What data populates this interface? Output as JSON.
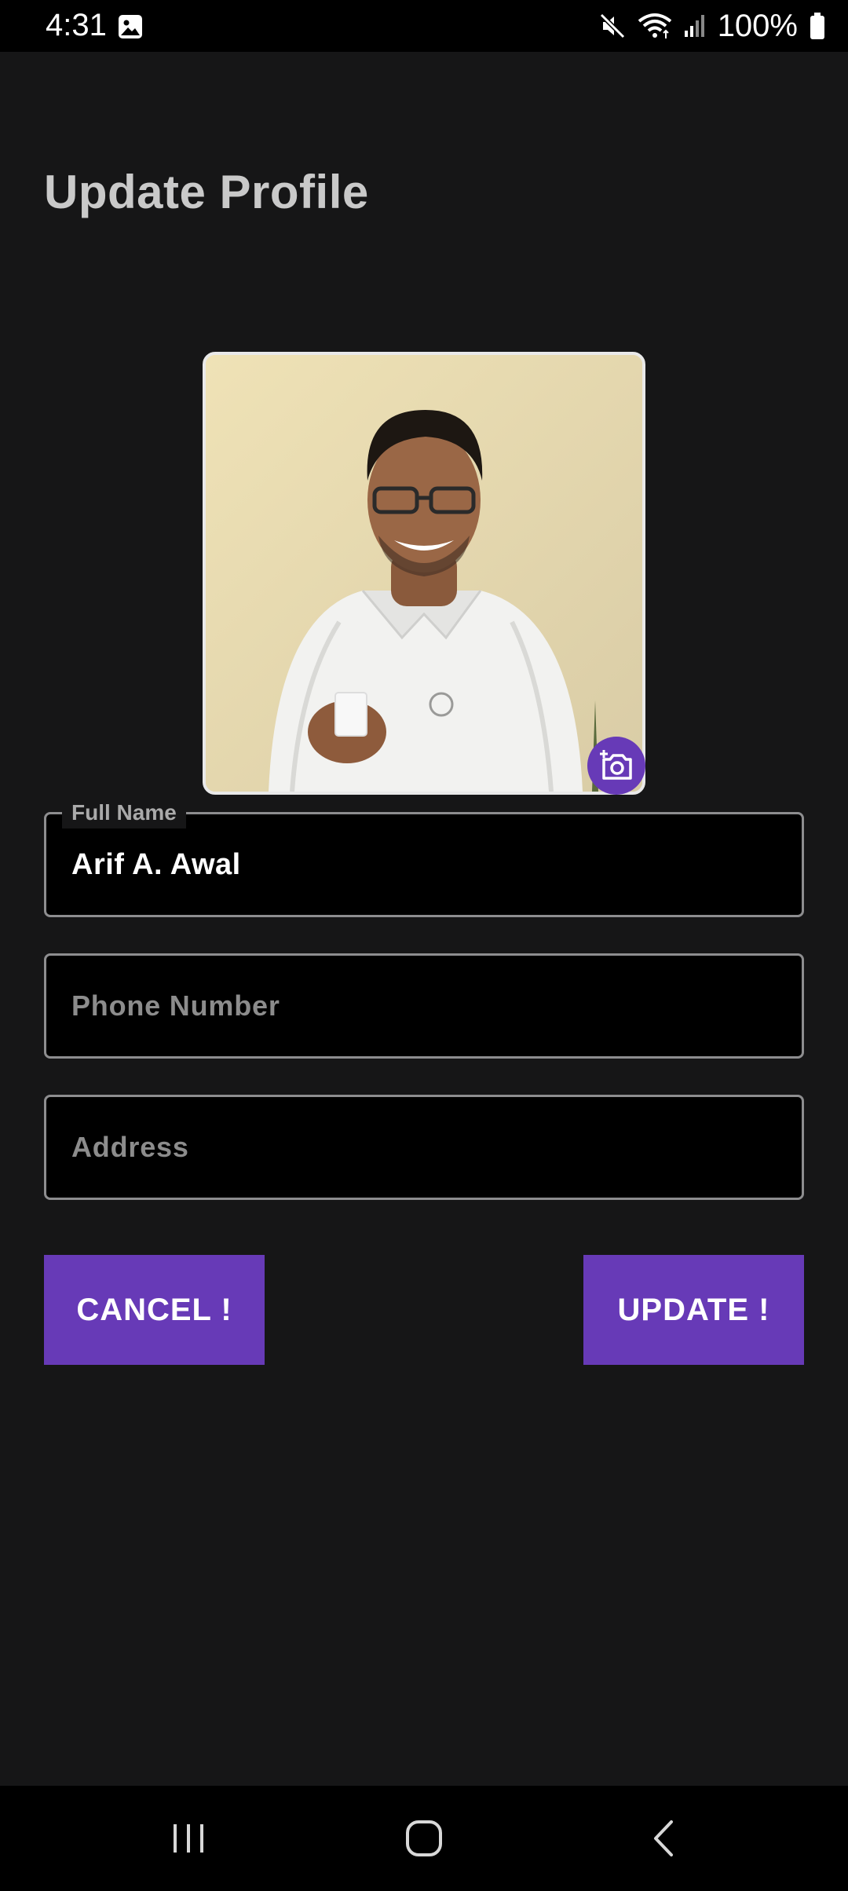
{
  "status_bar": {
    "time": "4:31",
    "battery": "100%",
    "icons": [
      "image-icon",
      "mute-icon",
      "wifi-icon",
      "signal-icon",
      "battery-icon"
    ]
  },
  "page": {
    "title": "Update Profile"
  },
  "avatar": {
    "description_icon": "profile-photo",
    "camera_icon": "add-photo-camera-icon"
  },
  "form": {
    "full_name": {
      "label": "Full Name",
      "value": "Arif A. Awal"
    },
    "phone": {
      "placeholder": "Phone Number",
      "value": ""
    },
    "address": {
      "placeholder": "Address",
      "value": ""
    }
  },
  "buttons": {
    "cancel": "CANCEL !",
    "update": "UPDATE !"
  },
  "nav": {
    "icons": [
      "recent-apps-icon",
      "home-icon",
      "back-icon"
    ]
  },
  "colors": {
    "background": "#161617",
    "accent": "#673ab7",
    "field_background": "#000000",
    "title": "#c9c9c9"
  }
}
